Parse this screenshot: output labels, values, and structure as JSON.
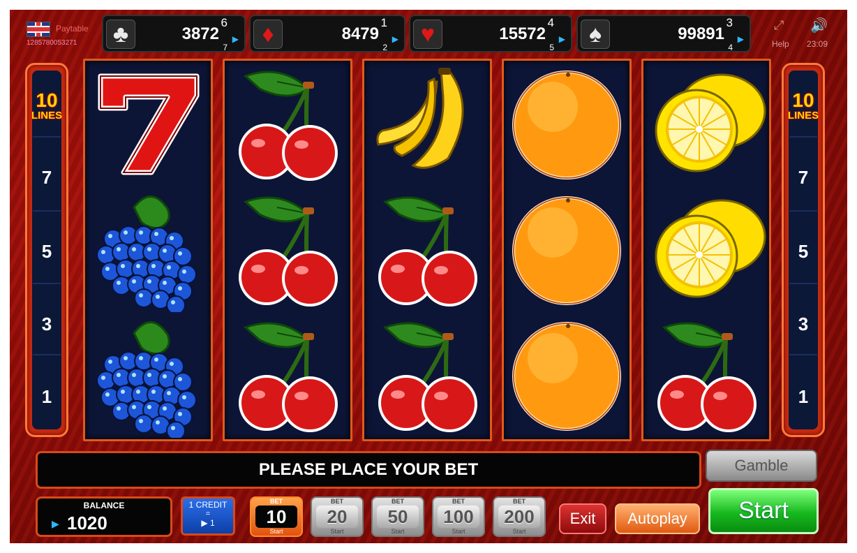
{
  "topbar": {
    "paytable_label": "Paytable",
    "game_id": "1285780053271",
    "help_label": "Help",
    "time": "23:09"
  },
  "jackpots": [
    {
      "suit": "clubs",
      "icon": "♣",
      "value": "3872",
      "sup": "6",
      "sub": "7",
      "color": "#e9e9e9"
    },
    {
      "suit": "diamonds",
      "icon": "♦",
      "value": "8479",
      "sup": "1",
      "sub": "2",
      "color": "#e11818"
    },
    {
      "suit": "hearts",
      "icon": "♥",
      "value": "15572",
      "sup": "4",
      "sub": "5",
      "color": "#e11818"
    },
    {
      "suit": "spades",
      "icon": "♠",
      "value": "99891",
      "sup": "3",
      "sub": "4",
      "color": "#e9e9e9"
    }
  ],
  "lines_panel": {
    "count": "10",
    "word": "LINES",
    "numbers": [
      "7",
      "5",
      "3",
      "1"
    ]
  },
  "reels": [
    [
      "seven",
      "grapes",
      "grapes"
    ],
    [
      "cherry",
      "cherry",
      "cherry"
    ],
    [
      "banana",
      "cherry",
      "cherry"
    ],
    [
      "orange",
      "orange",
      "orange"
    ],
    [
      "lemon",
      "lemon",
      "cherry"
    ]
  ],
  "message": "PLEASE PLACE YOUR BET",
  "gamble_label": "Gamble",
  "balance": {
    "label": "BALANCE",
    "value": "1020"
  },
  "credit": {
    "line1": "1 CREDIT",
    "line2": "=",
    "line3": "1"
  },
  "bets": [
    {
      "top": "BET",
      "value": "10",
      "bottom": "Start",
      "active": true
    },
    {
      "top": "BET",
      "value": "20",
      "bottom": "Start",
      "active": false
    },
    {
      "top": "BET",
      "value": "50",
      "bottom": "Start",
      "active": false
    },
    {
      "top": "BET",
      "value": "100",
      "bottom": "Start",
      "active": false
    },
    {
      "top": "BET",
      "value": "200",
      "bottom": "Start",
      "active": false
    }
  ],
  "exit_label": "Exit",
  "autoplay_label": "Autoplay",
  "start_label": "Start"
}
